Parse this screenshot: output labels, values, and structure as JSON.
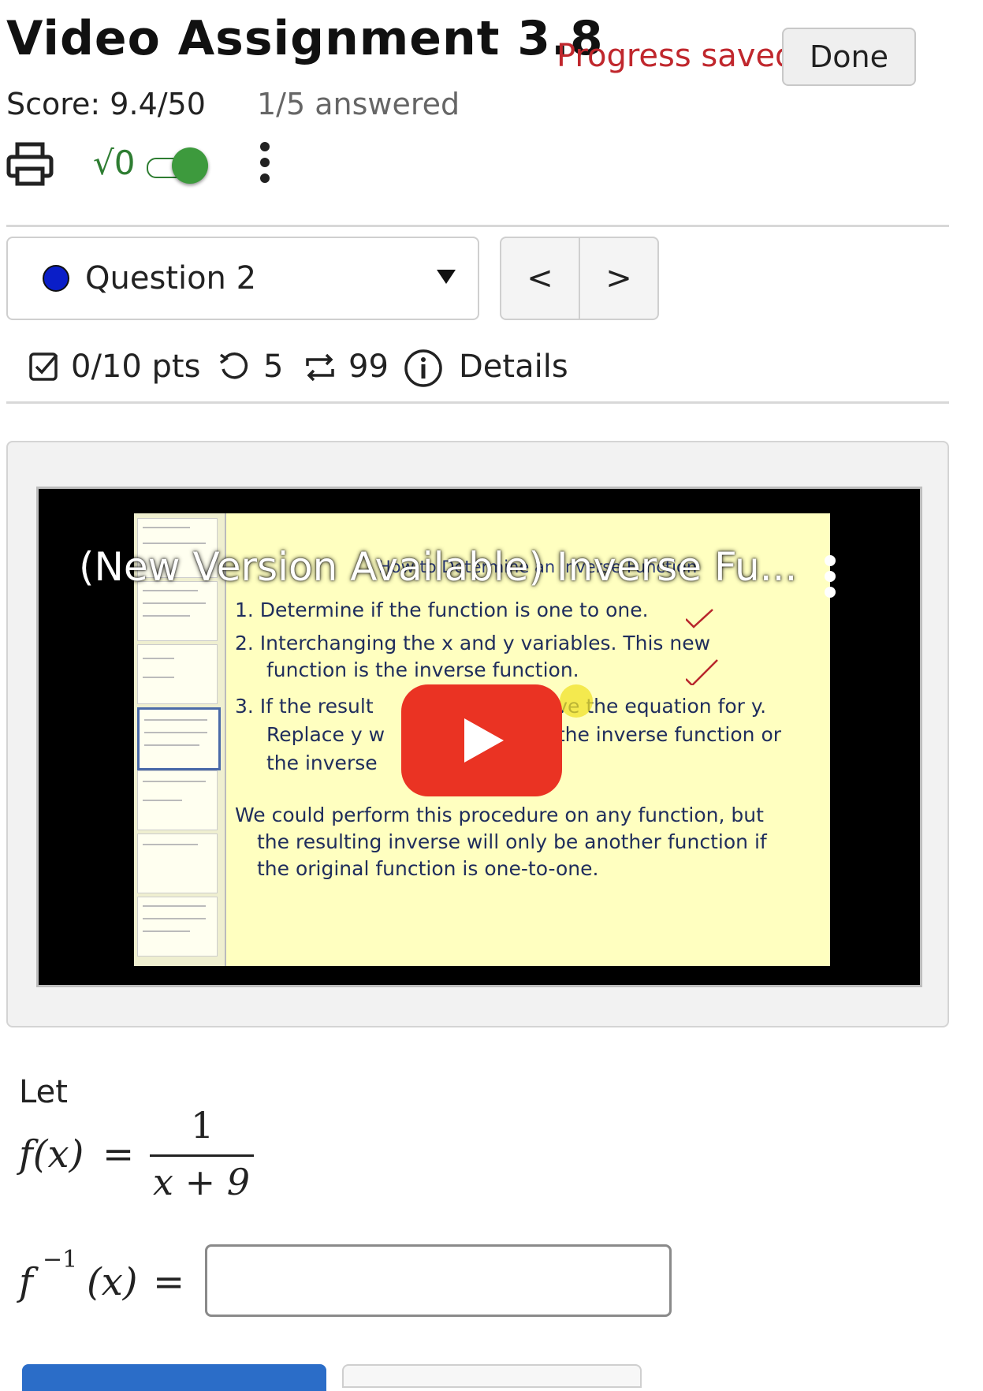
{
  "header": {
    "title": "Video Assignment 3.8",
    "progress_status": "Progress saved",
    "done_label": "Done",
    "score": "Score: 9.4/50",
    "answered": "1/5 answered"
  },
  "toolbar": {
    "print_icon": "printer-icon",
    "math_toggle_label": "√0",
    "math_toggle_on": true,
    "more_icon": "vertical-dots-icon"
  },
  "question_nav": {
    "selected_question": "Question 2",
    "prev_label": "<",
    "next_label": ">"
  },
  "question_meta": {
    "points": "0/10 pts",
    "attempts": "5",
    "versions": "99",
    "details_label": "Details"
  },
  "video": {
    "title": "(New Version Available) Inverse Fu...",
    "slide_heading": "How to Determine an Inverse Function",
    "slide_lines": [
      "1.  Determine if the function is one to one.",
      "2.  Interchanging the x and y variables.  This new",
      "function is the inverse  function.",
      "3.  If the result",
      "olve the equation for y.",
      "Replace y w",
      "g the inverse function or",
      "the inverse",
      "We could perform this procedure on any function, but",
      "the resulting inverse will only be another function if",
      "the original function is one-to-one."
    ],
    "play_icon": "youtube-play-icon",
    "menu_icon": "vertical-dots-icon",
    "colors": {
      "play": "#ea3323",
      "slide_bg": "#ffffc0"
    }
  },
  "problem": {
    "intro": "Let",
    "function_lhs": "f(x)",
    "numerator": "1",
    "denominator": "x + 9",
    "inverse_lhs_base": "f",
    "inverse_lhs_exp": "−1",
    "inverse_lhs_arg": "(x)",
    "equals": "=",
    "answer_value": ""
  },
  "colors": {
    "progress_text": "#c0272d",
    "toggle_green": "#3d9a3d",
    "question_dot": "#0a1ec8"
  }
}
